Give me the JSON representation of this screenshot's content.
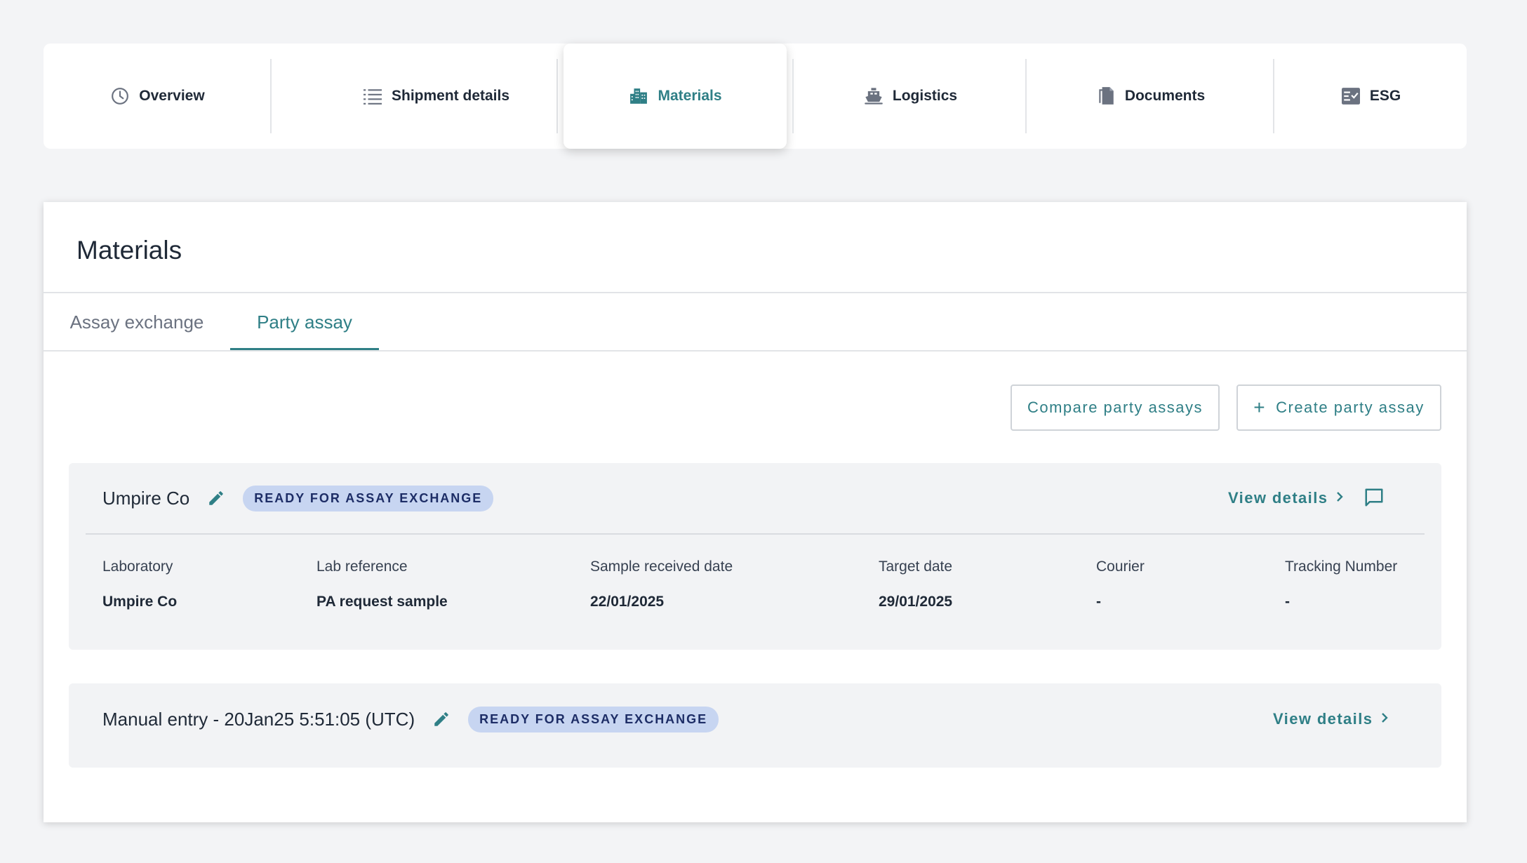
{
  "nav": {
    "tabs": [
      {
        "label": "Overview",
        "icon": "clock-icon"
      },
      {
        "label": "Shipment details",
        "icon": "list-icon"
      },
      {
        "label": "Materials",
        "icon": "buildings-icon"
      },
      {
        "label": "Logistics",
        "icon": "ship-icon"
      },
      {
        "label": "Documents",
        "icon": "documents-icon"
      },
      {
        "label": "ESG",
        "icon": "checklist-icon"
      }
    ],
    "active": "Materials"
  },
  "main": {
    "title": "Materials",
    "tabs": [
      {
        "label": "Assay exchange"
      },
      {
        "label": "Party assay"
      }
    ],
    "active_tab": "Party assay",
    "buttons": {
      "compare": "Compare party assays",
      "create": "Create party assay",
      "create_icon": "+"
    },
    "assays": [
      {
        "name": "Umpire Co",
        "badge": "READY FOR ASSAY EXCHANGE",
        "view_details": "View details",
        "fields": [
          {
            "label": "Laboratory",
            "value": "Umpire Co"
          },
          {
            "label": "Lab reference",
            "value": "PA request sample"
          },
          {
            "label": "Sample received date",
            "value": "22/01/2025"
          },
          {
            "label": "Target date",
            "value": "29/01/2025"
          },
          {
            "label": "Courier",
            "value": "-"
          },
          {
            "label": "Tracking Number",
            "value": "-"
          }
        ]
      },
      {
        "name": "Manual entry - 20Jan25 5:51:05 (UTC)",
        "badge": "READY FOR ASSAY EXCHANGE",
        "view_details": "View details"
      }
    ]
  },
  "colors": {
    "accent": "#2f7f86",
    "badge_bg": "#c7d5f1",
    "badge_text": "#1d2d66",
    "page_bg": "#f3f4f6"
  }
}
